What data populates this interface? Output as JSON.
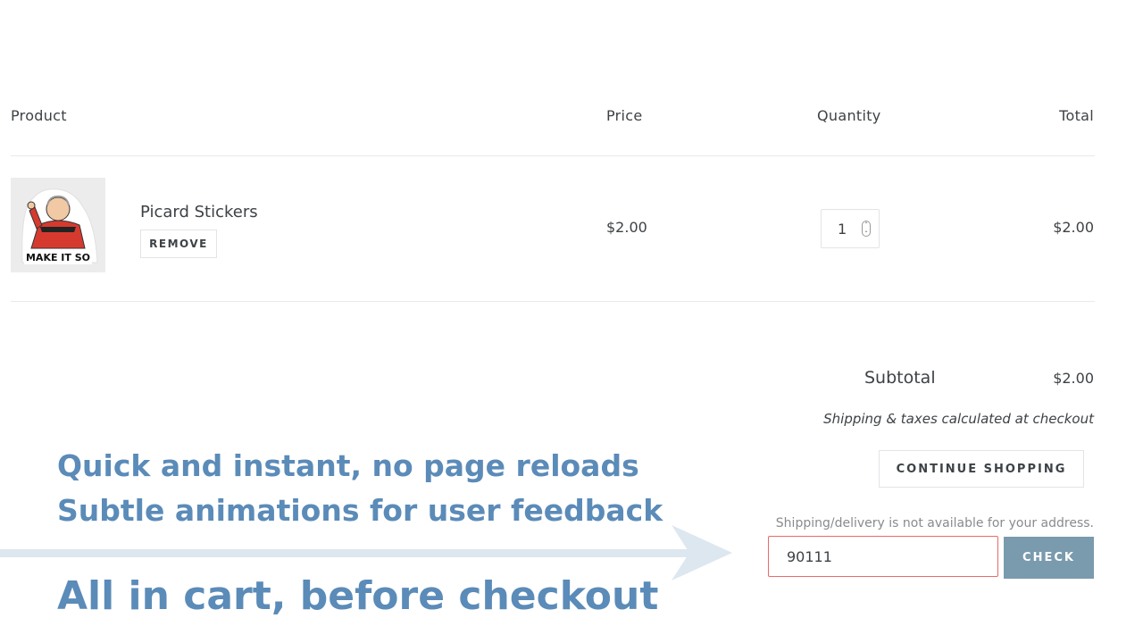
{
  "cart": {
    "headers": {
      "product": "Product",
      "price": "Price",
      "quantity": "Quantity",
      "total": "Total"
    },
    "items": [
      {
        "image_caption": "MAKE IT SO",
        "title": "Picard Stickers",
        "remove_label": "REMOVE",
        "price": "$2.00",
        "quantity": "1",
        "total": "$2.00"
      }
    ],
    "subtotal_label": "Subtotal",
    "subtotal_value": "$2.00",
    "shipping_note": "Shipping & taxes calculated at checkout",
    "continue_label": "CONTINUE SHOPPING"
  },
  "shipping_check": {
    "message": "Shipping/delivery is not available for your address.",
    "zip_value": "90111",
    "check_label": "CHECK"
  },
  "overlay": {
    "line1": "Quick and instant, no page reloads",
    "line2": "Subtle animations for user feedback",
    "line3": "All in cart, before checkout"
  },
  "colors": {
    "overlay_text": "#5b8bb8",
    "check_button": "#7a9aae",
    "error_border": "#e96a6a",
    "arrow": "#dde7f0"
  }
}
